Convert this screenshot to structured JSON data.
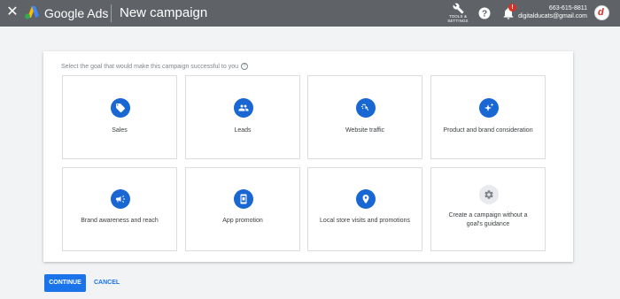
{
  "header": {
    "close_glyph": "✕",
    "brand": "Google Ads",
    "title": "New campaign",
    "tools_label": "TOOLS & SETTINGS",
    "notification_badge": "!",
    "account_phone": "663-615-8811",
    "account_email": "digitalducats@gmail.com",
    "avatar_letter": "d"
  },
  "main": {
    "instruction": "Select the goal that would make this campaign successful to you",
    "goals": [
      {
        "label": "Sales",
        "icon": "tag-icon"
      },
      {
        "label": "Leads",
        "icon": "people-icon"
      },
      {
        "label": "Website traffic",
        "icon": "cursor-click-icon"
      },
      {
        "label": "Product and brand consideration",
        "icon": "sparkle-icon"
      },
      {
        "label": "Brand awareness and reach",
        "icon": "megaphone-icon"
      },
      {
        "label": "App promotion",
        "icon": "phone-app-icon"
      },
      {
        "label": "Local store visits and promotions",
        "icon": "location-pin-icon"
      },
      {
        "label": "Create a campaign without a goal's guidance",
        "icon": "gear-icon"
      }
    ]
  },
  "actions": {
    "continue_label": "CONTINUE",
    "cancel_label": "CANCEL"
  },
  "colors": {
    "header_bg": "#5f6368",
    "accent": "#1a73e8",
    "icon_bg": "#1967d2"
  }
}
